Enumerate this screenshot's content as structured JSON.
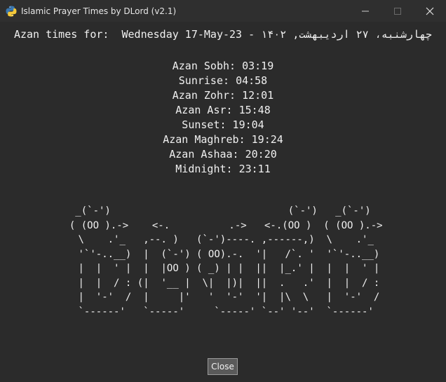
{
  "window": {
    "title": "Islamic Prayer Times by DLord (v2.1)"
  },
  "header": {
    "label": "Azan times for:",
    "date_text": "Wednesday 17-May-23 - ۱۴۰۲ ,چهارشنبه، ۲۷ اردیبهشت"
  },
  "times": [
    {
      "label": "Azan Sobh",
      "value": "03:19"
    },
    {
      "label": "Sunrise",
      "value": "04:58"
    },
    {
      "label": "Azan Zohr",
      "value": "12:01"
    },
    {
      "label": "Azan Asr",
      "value": "15:48"
    },
    {
      "label": "Sunset",
      "value": "19:04"
    },
    {
      "label": "Azan Maghreb",
      "value": "19:24"
    },
    {
      "label": "Azan Ashaa",
      "value": "20:20"
    },
    {
      "label": "Midnight",
      "value": "23:11"
    }
  ],
  "ascii_art": [
    "  _(`-')                              (`-')   _(`-')  ",
    " ( (OO ).->    <-.          .->   <-.(OO )  ( (OO ).->",
    "  \\    .'_   ,--. )   (`-')----. ,------,)  \\    .'_ ",
    "  '`'-..__)  |  (`-') ( OO).-.  '|   /`. '  '`'-..__)",
    "  |  |  ' |  |  |OO ) ( _) | |  ||  |_.' |  |  |  ' |",
    "  |  |  / : (|  '__ |  \\|  |)|  ||  .   .'  |  |  / :",
    "  |  '-'  /  |     |'   '  '-'  '|  |\\  \\   |  '-'  /",
    "  `------'   `-----'     `-----' `--' '--'  `------' "
  ],
  "buttons": {
    "close_label": "Close"
  },
  "icons": {
    "app": "python-icon",
    "minimize": "minimize-icon",
    "maximize": "maximize-icon",
    "close": "close-icon"
  },
  "colors": {
    "background": "#2b2b2b",
    "text": "#f0f0f0",
    "button_bg": "#5a5a5a"
  }
}
